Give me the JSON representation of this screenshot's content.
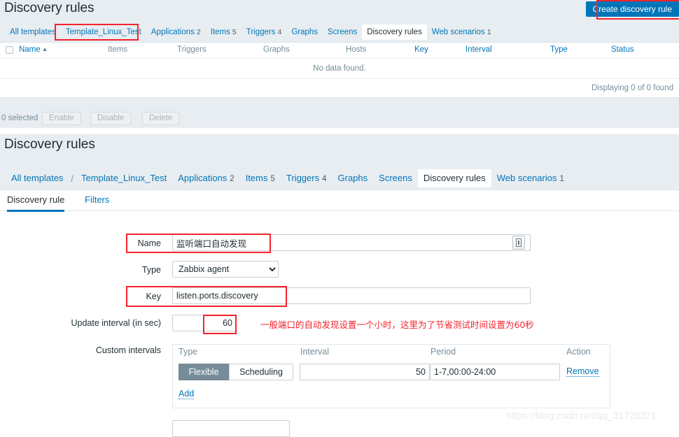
{
  "section1": {
    "title": "Discovery rules",
    "create_button": "Create discovery rule",
    "tabs": [
      {
        "label": "All templates",
        "count": "",
        "state": "link"
      },
      {
        "label": "Template_Linux_Test",
        "count": "",
        "state": "link"
      },
      {
        "label": "Applications",
        "count": "2",
        "state": "link"
      },
      {
        "label": "Items",
        "count": "5",
        "state": "link"
      },
      {
        "label": "Triggers",
        "count": "4",
        "state": "link"
      },
      {
        "label": "Graphs",
        "count": "",
        "state": "link"
      },
      {
        "label": "Screens",
        "count": "",
        "state": "link"
      },
      {
        "label": "Discovery rules",
        "count": "",
        "state": "active"
      },
      {
        "label": "Web scenarios",
        "count": "1",
        "state": "link"
      }
    ],
    "table": {
      "columns": [
        "Name",
        "Items",
        "Triggers",
        "Graphs",
        "Hosts",
        "Key",
        "Interval",
        "Type",
        "Status"
      ],
      "sort_column": "Name",
      "sort_direction": "asc",
      "empty_message": "No data found.",
      "displaying": "Displaying 0 of 0 found",
      "rows": []
    },
    "footer": {
      "selected": "0 selected",
      "buttons": [
        "Enable",
        "Disable",
        "Delete"
      ]
    }
  },
  "section2": {
    "title": "Discovery rules",
    "tabs": [
      {
        "label": "All templates",
        "count": "",
        "state": "link"
      },
      {
        "label": "Template_Linux_Test",
        "count": "",
        "state": "link"
      },
      {
        "label": "Applications",
        "count": "2",
        "state": "link"
      },
      {
        "label": "Items",
        "count": "5",
        "state": "link"
      },
      {
        "label": "Triggers",
        "count": "4",
        "state": "link"
      },
      {
        "label": "Graphs",
        "count": "",
        "state": "link"
      },
      {
        "label": "Screens",
        "count": "",
        "state": "link"
      },
      {
        "label": "Discovery rules",
        "count": "",
        "state": "active"
      },
      {
        "label": "Web scenarios",
        "count": "1",
        "state": "link"
      }
    ],
    "subtabs": [
      {
        "label": "Discovery rule",
        "selected": true
      },
      {
        "label": "Filters",
        "selected": false
      }
    ],
    "form": {
      "name_label": "Name",
      "name_value": "监听端口自动发现",
      "type_label": "Type",
      "type_value": "Zabbix agent",
      "type_options": [
        "Zabbix agent"
      ],
      "key_label": "Key",
      "key_value": "listen.ports.discovery",
      "update_interval_label": "Update interval (in sec)",
      "update_interval_value": "60",
      "update_interval_note": "一般端口的自动发现设置一个小时，这里为了节省测试时间设置为60秒",
      "custom_intervals_label": "Custom intervals",
      "custom_headers": [
        "Type",
        "Interval",
        "Period",
        "Action"
      ],
      "custom_rows": [
        {
          "type_flexible": "Flexible",
          "type_scheduling": "Scheduling",
          "type_selected": "Flexible",
          "interval": "50",
          "period": "1-7,00:00-24:00",
          "action": "Remove"
        }
      ],
      "add_link": "Add"
    }
  },
  "watermark": "https://blog.csdn.net/qq_31725371",
  "colors": {
    "accent": "#0275b8",
    "annotation": "#f5222d",
    "page_bg": "#e8edf1",
    "segment_on": "#768d99"
  }
}
